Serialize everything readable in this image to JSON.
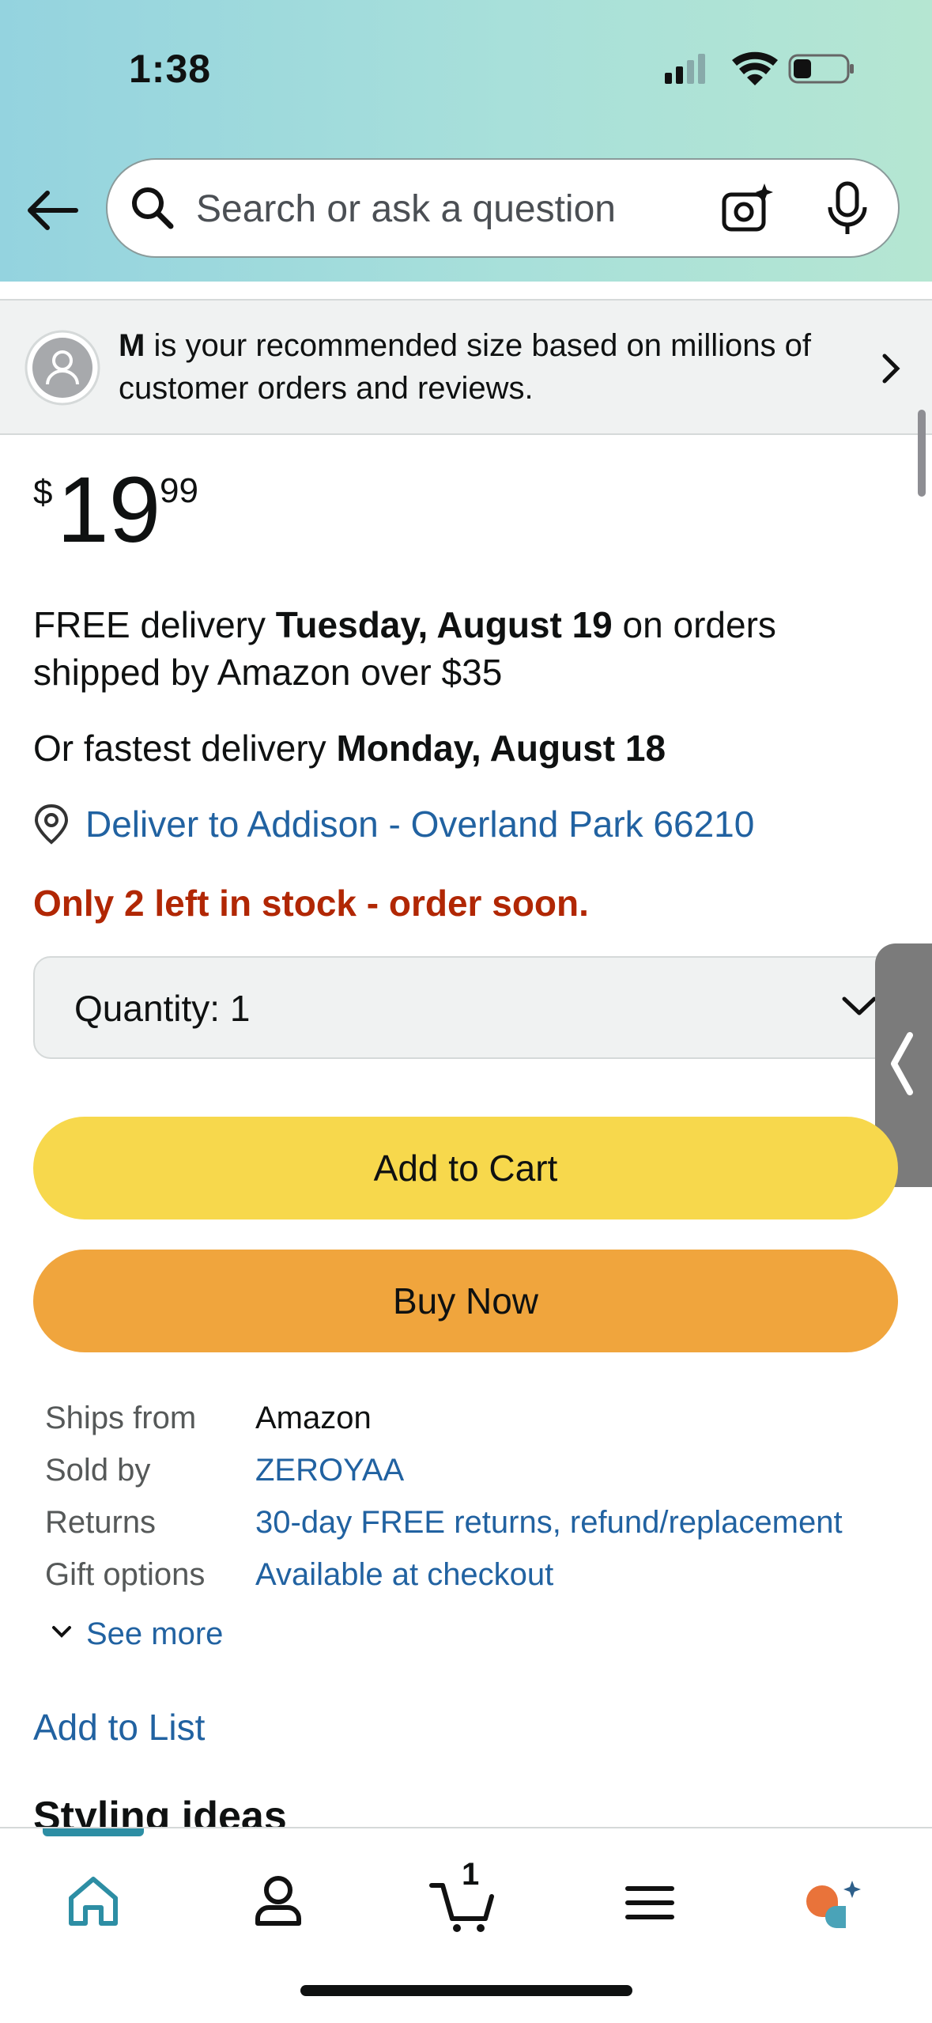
{
  "status_bar": {
    "time": "1:38"
  },
  "search": {
    "placeholder": "Search or ask a question"
  },
  "size_banner": {
    "size": "M",
    "text": " is your recommended size based on millions of customer orders and reviews."
  },
  "price": {
    "currency": "$",
    "whole": "19",
    "fraction": "99"
  },
  "delivery": {
    "free_prefix": "FREE delivery ",
    "free_date": "Tuesday, August 19",
    "free_suffix": " on orders shipped by Amazon over $35",
    "fast_prefix": "Or fastest delivery ",
    "fast_date": "Monday, August 18",
    "deliver_to": "Deliver to Addison - Overland Park 66210"
  },
  "stock": "Only 2 left in stock - order soon.",
  "quantity": {
    "label": "Quantity:",
    "value": "1"
  },
  "buttons": {
    "add_to_cart": "Add to Cart",
    "buy_now": "Buy Now"
  },
  "details": [
    {
      "label": "Ships from",
      "value": "Amazon"
    },
    {
      "label": "Sold by",
      "value": "ZEROYAA"
    },
    {
      "label": "Returns",
      "value": "30-day FREE returns, refund/replacement"
    },
    {
      "label": "Gift options",
      "value": "Available at checkout"
    }
  ],
  "see_more": "See more",
  "add_to_list": "Add to List",
  "section_heading": "Styling ideas",
  "tabbar": {
    "items": [
      "home-icon",
      "account-icon",
      "cart-icon",
      "menu-icon",
      "rufus-icon"
    ],
    "cart_count": "1"
  },
  "colors": {
    "link": "#2162a1",
    "stock": "#b12704",
    "add_to_cart": "#f7d84c",
    "buy_now": "#f0a53d",
    "active_tab": "#2d8ea4"
  }
}
